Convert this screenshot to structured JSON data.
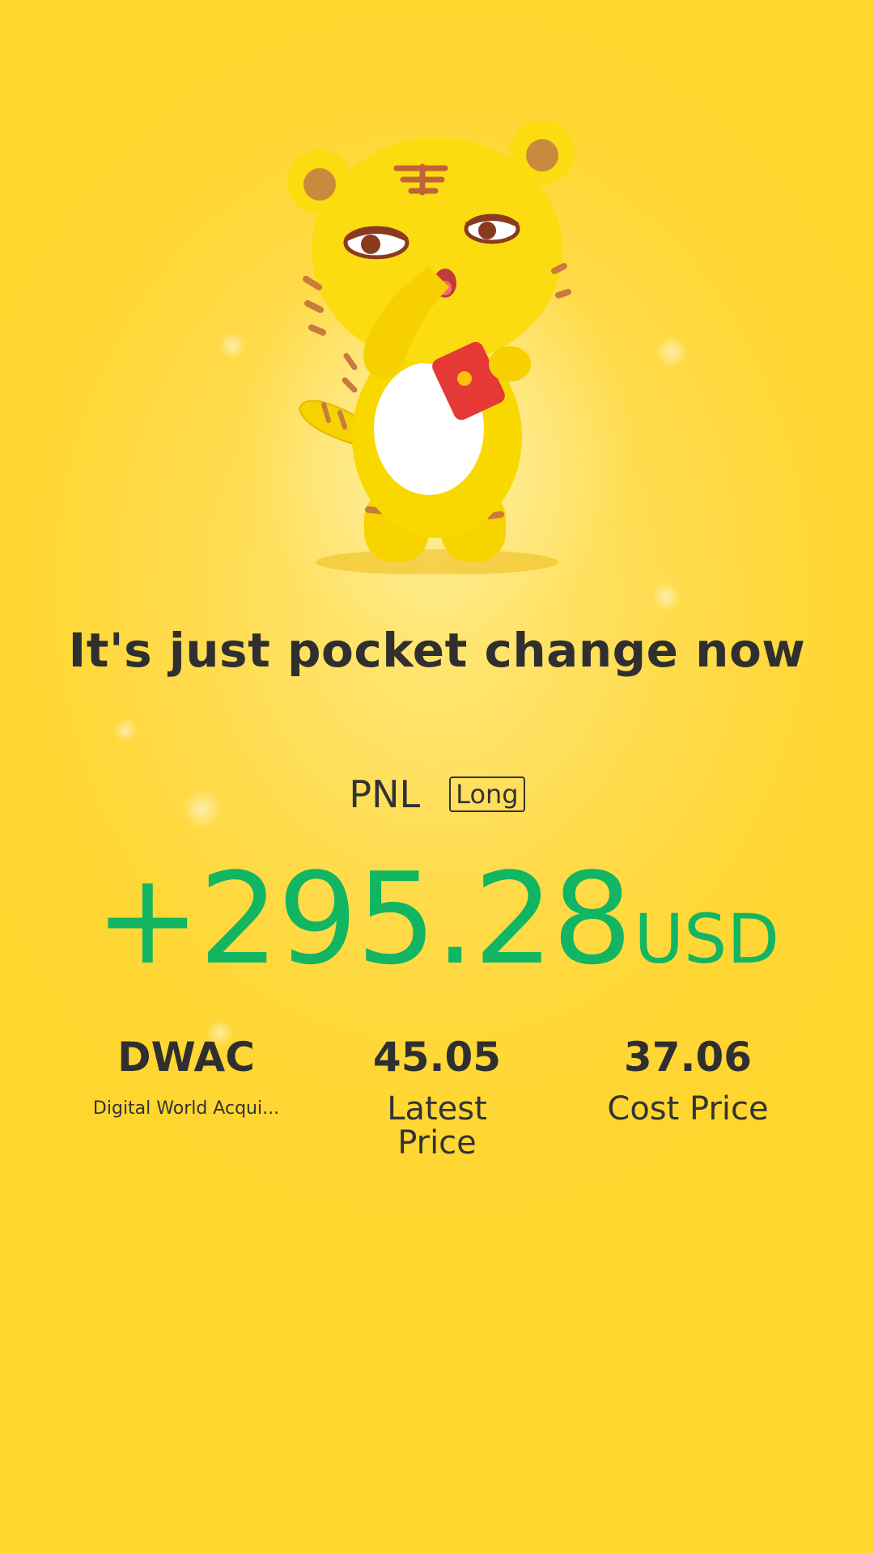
{
  "headline": "It's just pocket change now",
  "pnl": {
    "label": "PNL",
    "position_type": "Long",
    "value": "+295.28",
    "unit": "USD",
    "color": "#12B562"
  },
  "stats": {
    "symbol": {
      "value": "DWAC",
      "caption": "Digital World Acqui..."
    },
    "latest": {
      "value": "45.05",
      "caption": "Latest Price"
    },
    "cost": {
      "value": "37.06",
      "caption": "Cost Price"
    }
  },
  "theme": {
    "background": "#FFD62E",
    "text": "#2F2F2F"
  },
  "illustration": {
    "icon": "tiger-mascot-holding-red-envelope"
  }
}
